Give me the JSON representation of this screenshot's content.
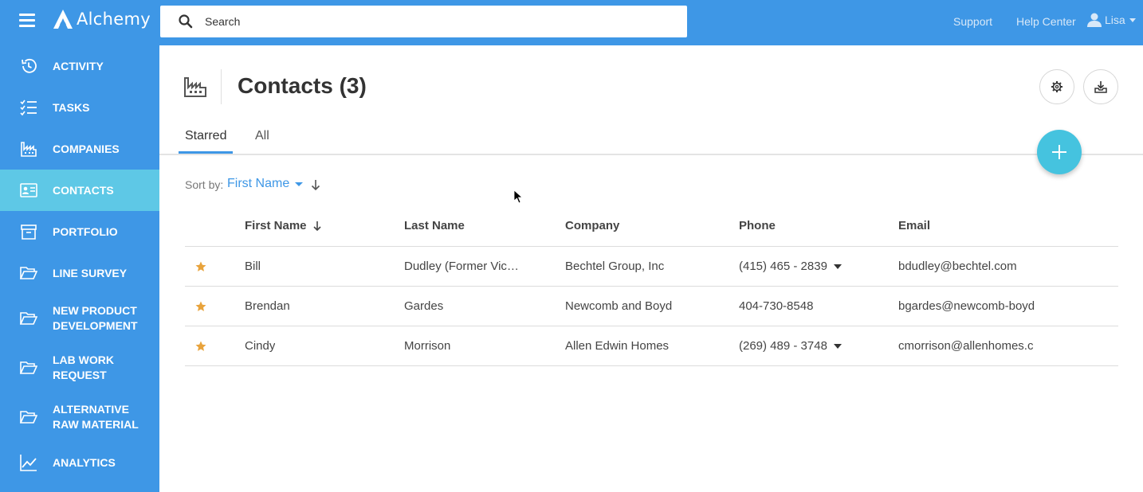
{
  "app": {
    "name": "Alchemy"
  },
  "topbar": {
    "search_placeholder": "Search",
    "links": {
      "support": "Support",
      "help_center": "Help Center"
    },
    "user_name": "Lisa"
  },
  "sidebar": {
    "items": [
      {
        "label": "ACTIVITY",
        "icon": "history-icon"
      },
      {
        "label": "TASKS",
        "icon": "checklist-icon"
      },
      {
        "label": "COMPANIES",
        "icon": "factory-icon"
      },
      {
        "label": "CONTACTS",
        "icon": "contact-card-icon",
        "active": true
      },
      {
        "label": "PORTFOLIO",
        "icon": "archive-box-icon"
      },
      {
        "label": "LINE SURVEY",
        "icon": "folder-open-icon"
      },
      {
        "label": "NEW PRODUCT DEVELOPMENT",
        "icon": "folder-open-icon"
      },
      {
        "label": "LAB WORK REQUEST",
        "icon": "folder-open-icon"
      },
      {
        "label": "ALTERNATIVE RAW MATERIAL",
        "icon": "folder-open-icon"
      },
      {
        "label": "ANALYTICS",
        "icon": "trend-chart-icon"
      }
    ]
  },
  "page": {
    "title": "Contacts (3)",
    "tabs": [
      {
        "label": "Starred",
        "active": true
      },
      {
        "label": "All",
        "active": false
      }
    ],
    "sort": {
      "label": "Sort by:",
      "value": "First Name"
    }
  },
  "table": {
    "columns": [
      "First Name",
      "Last Name",
      "Company",
      "Phone",
      "Email"
    ],
    "rows": [
      {
        "first": "Bill",
        "last": "Dudley (Former Vic…",
        "company": "Bechtel Group, Inc",
        "phone": "(415) 465 - 2839",
        "email": "bdudley@bechtel.com",
        "starred": true
      },
      {
        "first": "Brendan",
        "last": "Gardes",
        "company": "Newcomb and Boyd",
        "phone": "404-730-8548",
        "email": "bgardes@newcomb-boyd",
        "starred": true
      },
      {
        "first": "Cindy",
        "last": "Morrison",
        "company": "Allen Edwin Homes",
        "phone": "(269) 489 - 3748",
        "email": "cmorrison@allenhomes.c",
        "starred": true
      }
    ]
  },
  "colors": {
    "brand_blue": "#3e97e6",
    "active_nav": "#5ec8e6",
    "fab": "#45c3df",
    "star": "#e8a33c"
  }
}
